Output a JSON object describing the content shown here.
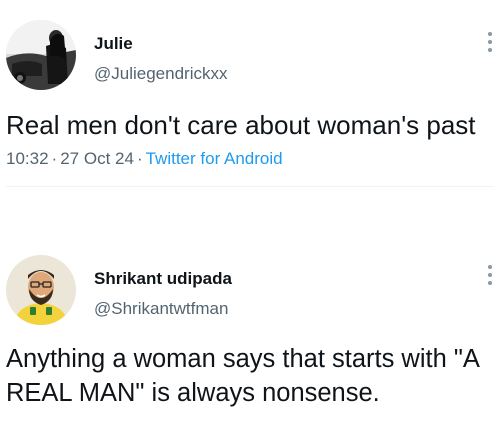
{
  "tweets": [
    {
      "author": {
        "name": "Julie",
        "handle": "@Juliegendrickxx",
        "avatar_icon": "profile-photo-julie"
      },
      "text": "Real men don't care about woman's past",
      "time": "10:32",
      "date": "27 Oct 24",
      "client": "Twitter for Android",
      "separator": "·"
    },
    {
      "author": {
        "name": "Shrikant udipada",
        "handle": "@Shrikantwtfman",
        "avatar_icon": "cartoon-avatar-shrikant"
      },
      "text": "Anything a woman says that starts with \"A REAL MAN\" is always nonsense."
    }
  ],
  "colors": {
    "text": "#0f1419",
    "secondary": "#536471",
    "link": "#1d9bf0",
    "more_dots": "#8899a6"
  }
}
